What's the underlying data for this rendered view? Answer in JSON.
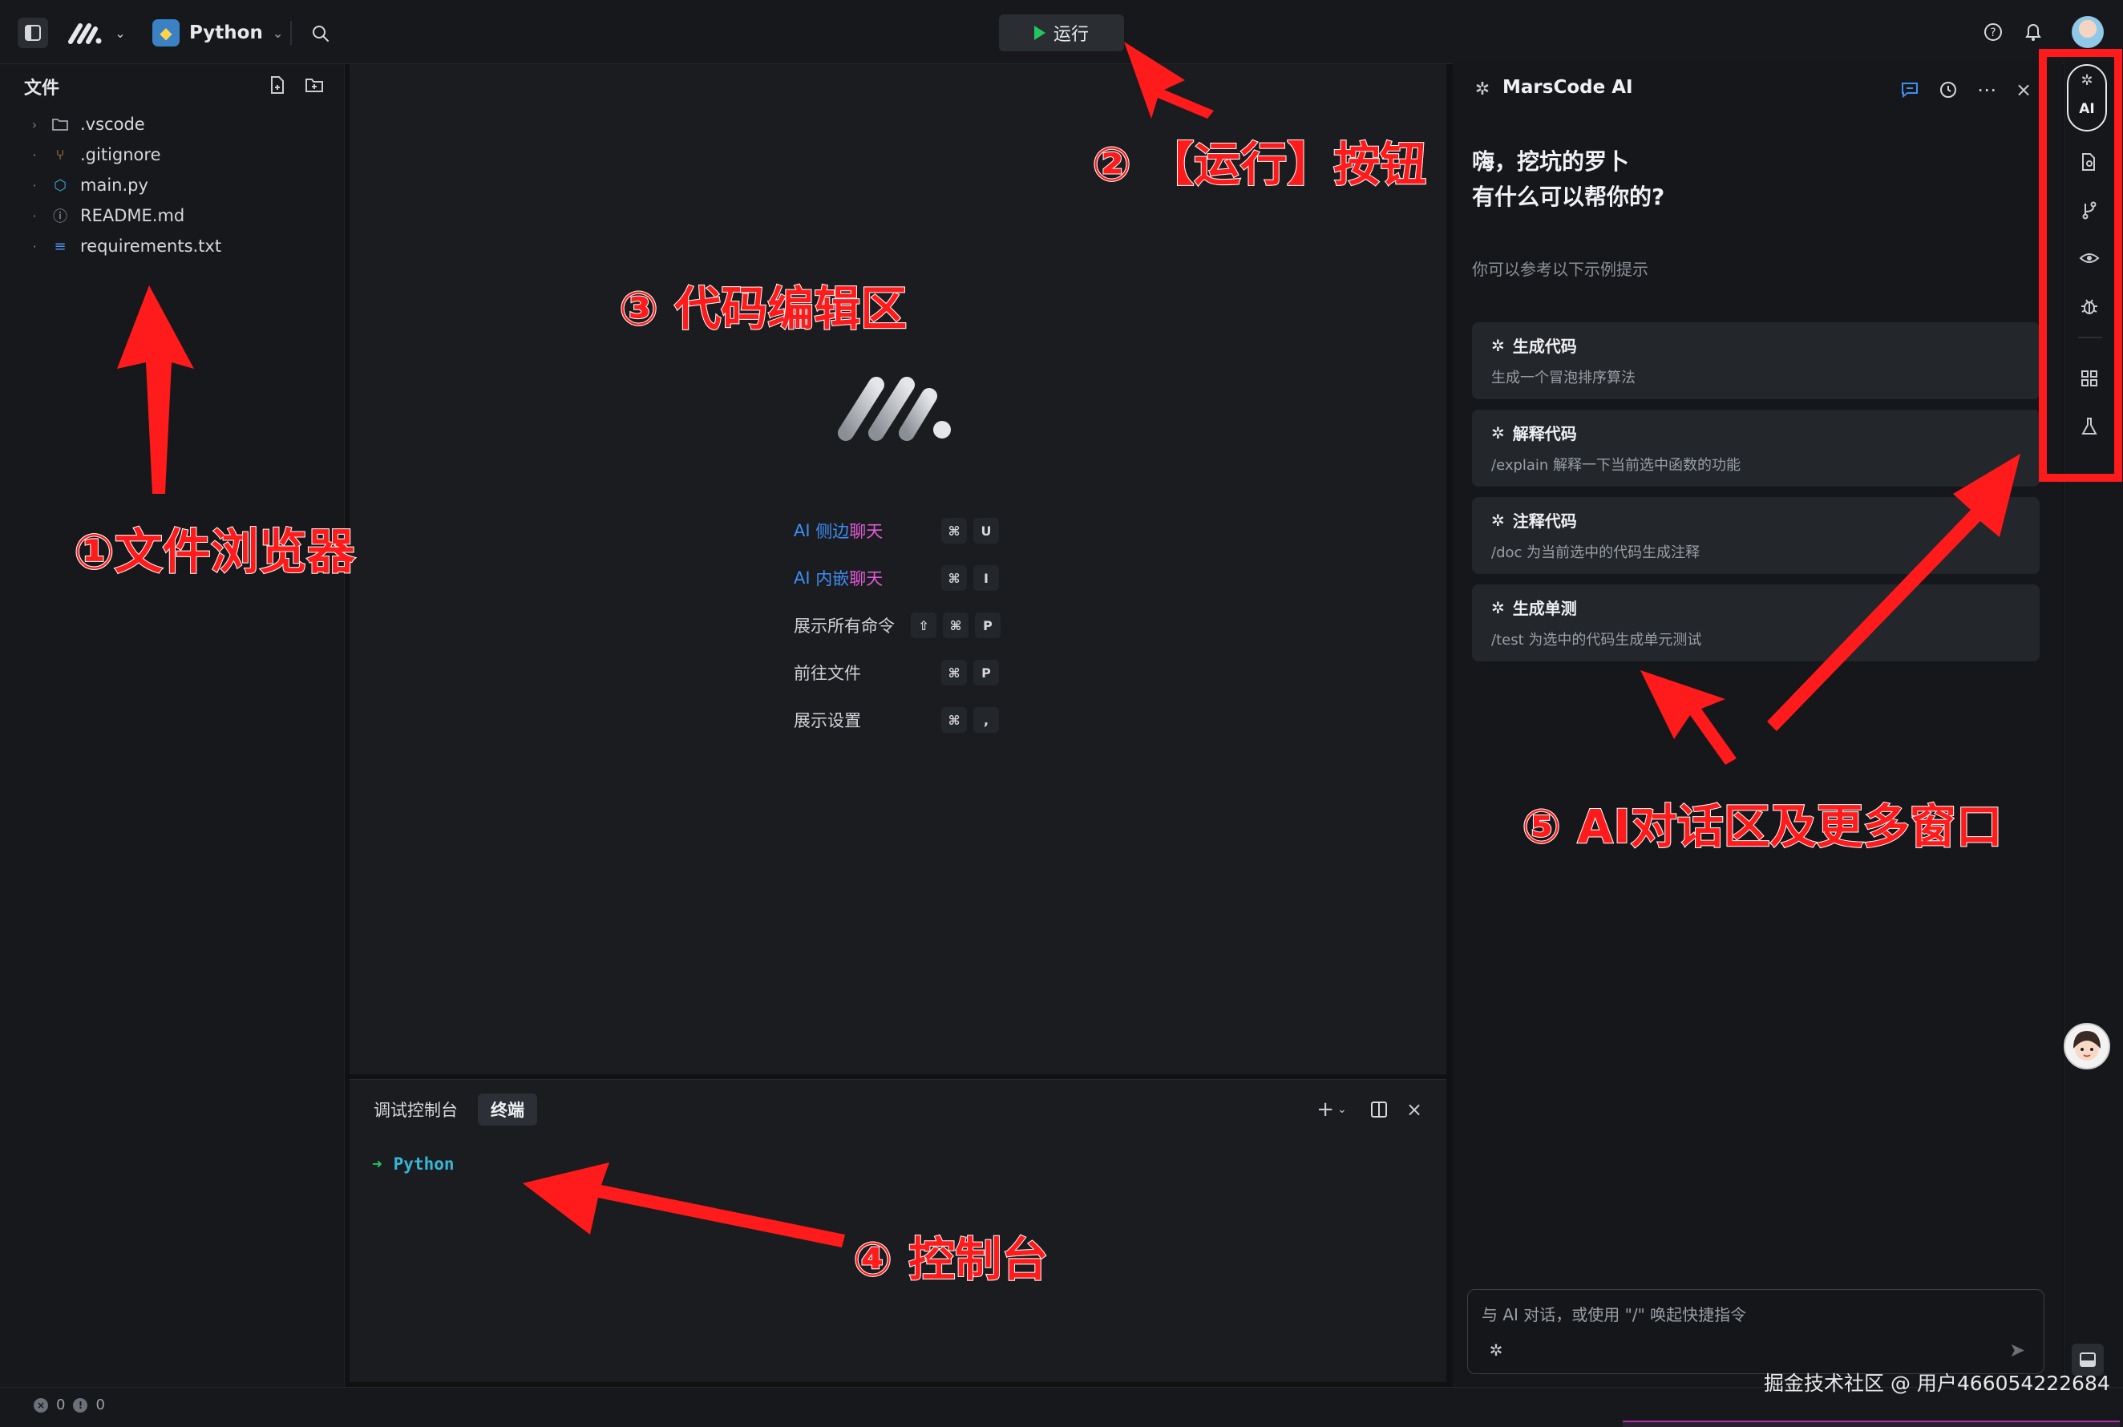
{
  "topbar": {
    "project": "Python",
    "run_label": "运行",
    "icons": [
      "sidebar-toggle-icon",
      "marscode-logo-icon",
      "chevron-down-icon",
      "python-icon",
      "search-icon",
      "help-icon",
      "bell-icon",
      "avatar"
    ]
  },
  "sidebar": {
    "title": "文件",
    "files": [
      {
        "name": ".vscode",
        "icon": "folder-icon",
        "expandable": true
      },
      {
        "name": ".gitignore",
        "icon": "git-icon"
      },
      {
        "name": "main.py",
        "icon": "python-file-icon"
      },
      {
        "name": "README.md",
        "icon": "info-icon"
      },
      {
        "name": "requirements.txt",
        "icon": "list-icon"
      }
    ]
  },
  "editor": {
    "shortcuts": [
      {
        "ai": "AI",
        "a": "侧边",
        "b": "聊天",
        "keys": [
          "⌘",
          "U"
        ]
      },
      {
        "ai": "AI",
        "a": "内嵌",
        "b": "聊天",
        "keys": [
          "⌘",
          "I"
        ]
      },
      {
        "label": "展示所有命令",
        "keys": [
          "⇧",
          "⌘",
          "P"
        ]
      },
      {
        "label": "前往文件",
        "keys": [
          "⌘",
          "P"
        ]
      },
      {
        "label": "展示设置",
        "keys": [
          "⌘",
          ","
        ]
      }
    ]
  },
  "panel": {
    "tabs": [
      "调试控制台",
      "终端"
    ],
    "active_tab": "终端",
    "prompt_arrow": "➜",
    "prompt_text": "Python"
  },
  "ai": {
    "title": "MarsCode AI",
    "greeting_line1": "嗨，挖坑的罗卜",
    "greeting_line2": "有什么可以帮你的?",
    "hint": "你可以参考以下示例提示",
    "suggestions": [
      {
        "title": "生成代码",
        "desc": "生成一个冒泡排序算法"
      },
      {
        "title": "解释代码",
        "desc": "/explain 解释一下当前选中函数的功能"
      },
      {
        "title": "注释代码",
        "desc": "/doc 为当前选中的代码生成注释"
      },
      {
        "title": "生成单测",
        "desc": "/test 为选中的代码生成单元测试"
      }
    ],
    "input_placeholder": "与 AI 对话，或使用 \"/\" 唤起快捷指令"
  },
  "actbar": {
    "ai_label": "AI",
    "icons": [
      "ai-sparkle-icon",
      "file-search-icon",
      "branch-icon",
      "eye-icon",
      "bug-icon",
      "grid-icon",
      "flask-icon",
      "mascot-avatar",
      "panel-toggle-icon"
    ]
  },
  "status": {
    "errors": "0",
    "warnings": "0"
  },
  "annotations": {
    "a1": "①文件浏览器",
    "a2": "② 【运行】按钮",
    "a3": "③ 代码编辑区",
    "a4": "④ 控制台",
    "a5": "⑤ AI对话区及更多窗口"
  },
  "watermark": "掘金技术社区 @ 用户466054222684",
  "colors": {
    "annotation": "#ff1b1b",
    "accent_blue": "#3f8ef5",
    "accent_pink": "#e05bd6",
    "run_green": "#22c55e",
    "terminal_cyan": "#37b7d6"
  }
}
